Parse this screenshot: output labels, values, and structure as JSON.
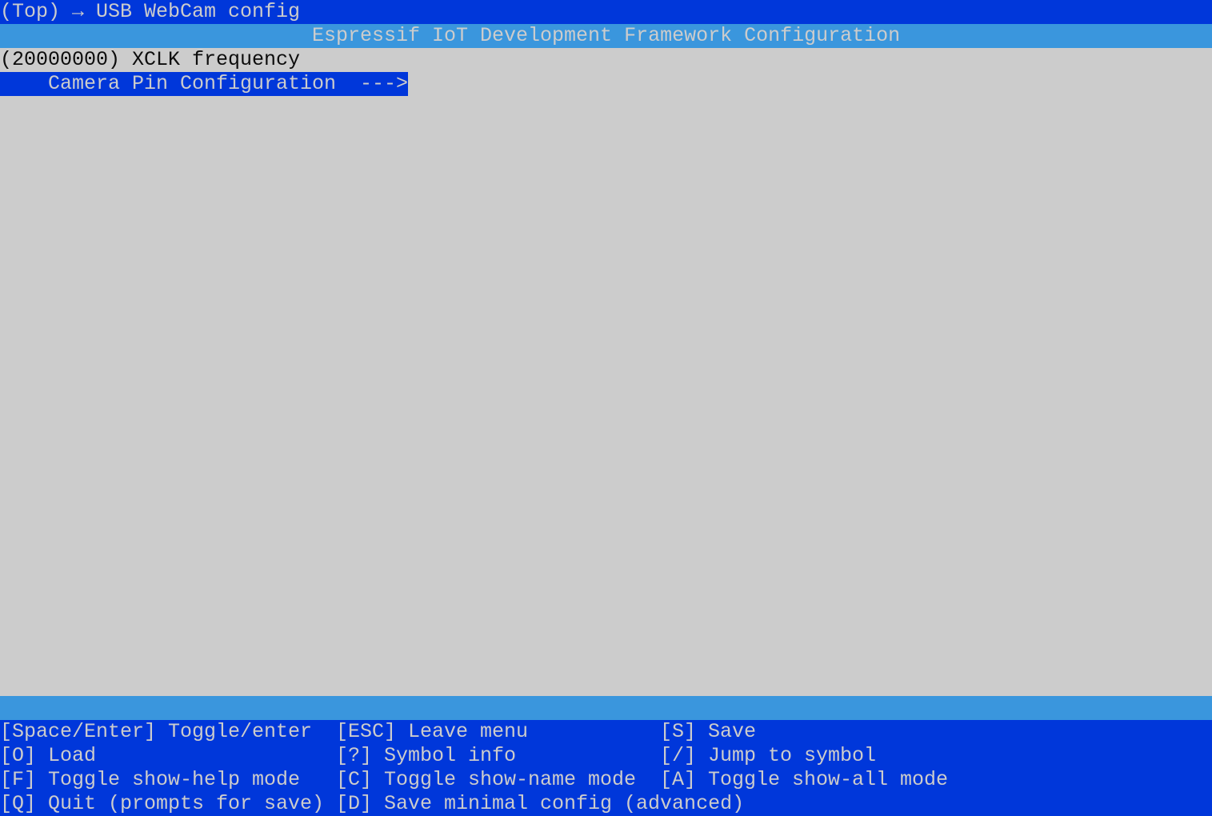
{
  "breadcrumb": {
    "root": "(Top)",
    "arrow": "→",
    "current": "USB WebCam config"
  },
  "title": "Espressif IoT Development Framework Configuration",
  "menu": {
    "items": [
      {
        "value": "(20000000)",
        "label": "XCLK frequency",
        "selected": false
      },
      {
        "label": "Camera Pin Configuration",
        "submenu_arrow": "--->",
        "selected": true
      }
    ]
  },
  "help": {
    "rows": [
      [
        {
          "key": "[Space/Enter]",
          "action": "Toggle/enter"
        },
        {
          "key": "[ESC]",
          "action": "Leave menu"
        },
        {
          "key": "[S]",
          "action": "Save"
        }
      ],
      [
        {
          "key": "[O]",
          "action": "Load"
        },
        {
          "key": "[?]",
          "action": "Symbol info"
        },
        {
          "key": "[/]",
          "action": "Jump to symbol"
        }
      ],
      [
        {
          "key": "[F]",
          "action": "Toggle show-help mode"
        },
        {
          "key": "[C]",
          "action": "Toggle show-name mode"
        },
        {
          "key": "[A]",
          "action": "Toggle show-all mode"
        }
      ],
      [
        {
          "key": "[Q]",
          "action": "Quit (prompts for save)"
        },
        {
          "key": "[D]",
          "action": "Save minimal config (advanced)"
        }
      ]
    ]
  },
  "colors": {
    "dark_blue": "#0037DA",
    "light_blue": "#3A96DD",
    "background": "#CCCCCC",
    "text_dark": "#0C0C0C"
  }
}
